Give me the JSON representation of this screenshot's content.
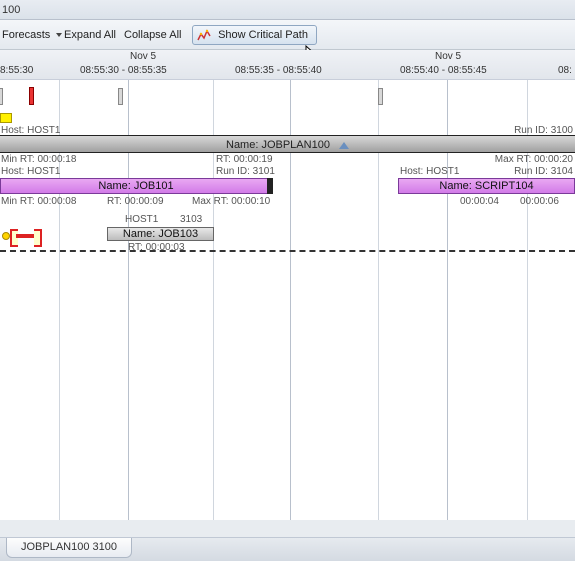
{
  "window_title_fragment": "100",
  "toolbar": {
    "forecasts": "Forecasts",
    "expand_all": "Expand All",
    "collapse_all": "Collapse All",
    "show_critical_path": "Show Critical Path"
  },
  "timeline": {
    "day1_label": "Nov 5",
    "day2_label": "Nov 5",
    "range1": "8:55:30",
    "range2": "08:55:30 - 08:55:35",
    "range3": "08:55:35 - 08:55:40",
    "range4": "08:55:40 - 08:55:45",
    "range5": "08:"
  },
  "row_host": {
    "host": "Host: HOST1",
    "runid": "Run ID: 3100"
  },
  "jobplan": {
    "header": "Name: JOBPLAN100"
  },
  "row_minmax": {
    "min": "Min RT: 00:00:18",
    "mid": "RT: 00:00:19",
    "max": "Max RT: 00:00:20"
  },
  "row_host2": {
    "host": "Host: HOST1",
    "runid": "Run ID: 3101",
    "host_r": "Host: HOST1",
    "runid_r": "Run ID: 3104"
  },
  "job101": {
    "label": "Name: JOB101"
  },
  "script104": {
    "label": "Name: SCRIPT104"
  },
  "row_rt": {
    "min": "Min RT: 00:00:08",
    "mid": "RT: 00:00:09",
    "max": "Max RT: 00:00:10",
    "r1": "00:00:04",
    "r2": "00:00:06"
  },
  "row_job103_top": {
    "host": "HOST1",
    "runid": "3103"
  },
  "job103": {
    "label": "Name: JOB103"
  },
  "row_job103_rt": {
    "rt": "RT: 00:00:03"
  },
  "footer": {
    "tab": "JOBPLAN100 3100"
  }
}
